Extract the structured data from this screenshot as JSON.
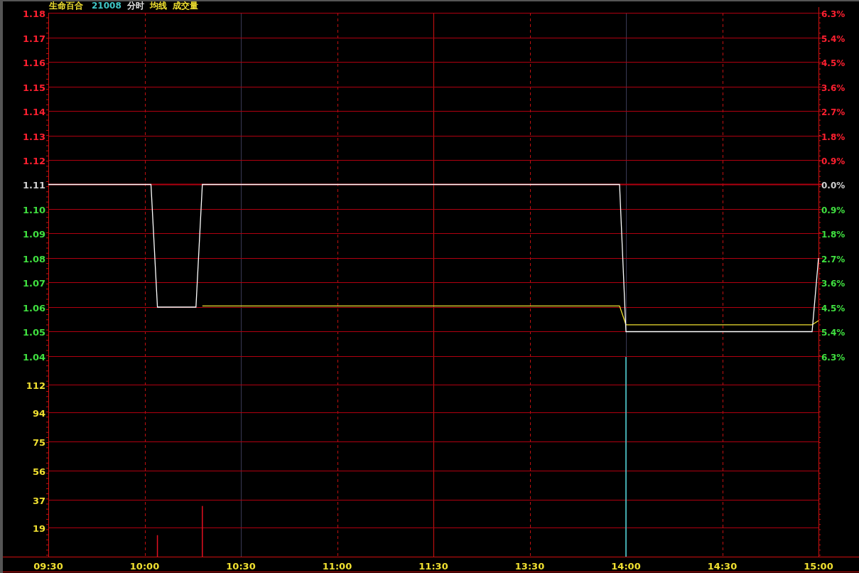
{
  "header": [
    {
      "kind": "name",
      "text": "生命百合",
      "color": "#f0e030"
    },
    {
      "kind": "code",
      "text": "21008",
      "color": "#40c8c8"
    },
    {
      "kind": "label",
      "text": "分时",
      "color": "#e0e0e0"
    },
    {
      "kind": "label",
      "text": "均线",
      "color": "#f0e030"
    },
    {
      "kind": "label",
      "text": "成交量",
      "color": "#f0e030"
    }
  ],
  "axis_rows": [
    {
      "percent": "6.3%",
      "color": "#ff2030"
    },
    {
      "percent": "5.4%",
      "color": "#ff2030"
    },
    {
      "percent": "4.5%",
      "color": "#ff2030"
    },
    {
      "percent": "3.6%",
      "color": "#ff2030"
    },
    {
      "percent": "2.7%",
      "color": "#ff2030"
    },
    {
      "percent": "1.8%",
      "color": "#ff2030"
    },
    {
      "percent": "0.9%",
      "color": "#ff2030"
    },
    {
      "percent": "0.0%",
      "color": "#d0d0d0"
    },
    {
      "percent": "0.9%",
      "color": "#40e040"
    },
    {
      "percent": "1.8%",
      "color": "#40e040"
    },
    {
      "percent": "2.7%",
      "color": "#40e040"
    },
    {
      "percent": "3.6%",
      "color": "#40e040"
    },
    {
      "percent": "4.5%",
      "color": "#40e040"
    },
    {
      "percent": "5.4%",
      "color": "#40e040"
    },
    {
      "percent": "6.3%",
      "color": "#40e040"
    }
  ],
  "price_chart": {
    "chart_data": {
      "type": "line",
      "categories": [
        null,
        null,
        null,
        null,
        null,
        null,
        null,
        null,
        null,
        null,
        null,
        null,
        null,
        null,
        null,
        null,
        null,
        null,
        null,
        null,
        null,
        null,
        null,
        null,
        null,
        null,
        null,
        null,
        null,
        null,
        null,
        null,
        null,
        null,
        null,
        null,
        null,
        null,
        null,
        null,
        null,
        null,
        null,
        null,
        null,
        null,
        null,
        null,
        null,
        null,
        null,
        null,
        null,
        null,
        null,
        null,
        null,
        null,
        null,
        null,
        null,
        null,
        null,
        null,
        null,
        null,
        null,
        null,
        null,
        null,
        null,
        null,
        null,
        null,
        null,
        null,
        null,
        null,
        null,
        null,
        null,
        null,
        null,
        null,
        null,
        null,
        null,
        null,
        null,
        null,
        null,
        null,
        null,
        null,
        null,
        null,
        null,
        null,
        null,
        null,
        null,
        null,
        null,
        null,
        null,
        null,
        null,
        null,
        null,
        null,
        null,
        null,
        null,
        null,
        null,
        null,
        null,
        null,
        null,
        null,
        null
      ],
      "series": [
        {
          "color": "#ffffff",
          "values": [
            1.11,
            1.11,
            1.11,
            1.11,
            1.11,
            1.11,
            1.11,
            1.11,
            1.11,
            1.11,
            1.11,
            1.11,
            1.11,
            1.11,
            1.11,
            1.11,
            1.11,
            1.06,
            1.06,
            1.06,
            1.06,
            1.06,
            1.06,
            1.06,
            1.11,
            1.11,
            1.11,
            1.11,
            1.11,
            1.11,
            1.11,
            1.11,
            1.11,
            1.11,
            1.11,
            1.11,
            1.11,
            1.11,
            1.11,
            1.11,
            1.11,
            1.11,
            1.11,
            1.11,
            1.11,
            1.11,
            1.11,
            1.11,
            1.11,
            1.11,
            1.11,
            1.11,
            1.11,
            1.11,
            1.11,
            1.11,
            1.11,
            1.11,
            1.11,
            1.11,
            1.11,
            1.11,
            1.11,
            1.11,
            1.11,
            1.11,
            1.11,
            1.11,
            1.11,
            1.11,
            1.11,
            1.11,
            1.11,
            1.11,
            1.11,
            1.11,
            1.11,
            1.11,
            1.11,
            1.11,
            1.11,
            1.11,
            1.11,
            1.11,
            1.11,
            1.11,
            1.11,
            1.11,
            1.11,
            1.11,
            1.05,
            1.05,
            1.05,
            1.05,
            1.05,
            1.05,
            1.05,
            1.05,
            1.05,
            1.05,
            1.05,
            1.05,
            1.05,
            1.05,
            1.05,
            1.05,
            1.05,
            1.05,
            1.05,
            1.05,
            1.05,
            1.05,
            1.05,
            1.05,
            1.05,
            1.05,
            1.05,
            1.05,
            1.05,
            1.05,
            1.08
          ]
        },
        {
          "color": "#f0e030",
          "values": [
            null,
            null,
            null,
            null,
            null,
            null,
            null,
            null,
            null,
            null,
            null,
            null,
            null,
            null,
            null,
            null,
            null,
            null,
            null,
            null,
            null,
            null,
            null,
            null,
            1.0605,
            1.0605,
            1.0605,
            1.0605,
            1.0605,
            1.0605,
            1.0605,
            1.0605,
            1.0605,
            1.0605,
            1.0605,
            1.0605,
            1.0605,
            1.0605,
            1.0605,
            1.0605,
            1.0605,
            1.0605,
            1.0605,
            1.0605,
            1.0605,
            1.0605,
            1.0605,
            1.0605,
            1.0605,
            1.0605,
            1.0605,
            1.0605,
            1.0605,
            1.0605,
            1.0605,
            1.0605,
            1.0605,
            1.0605,
            1.0605,
            1.0605,
            1.0605,
            1.0605,
            1.0605,
            1.0605,
            1.0605,
            1.0605,
            1.0605,
            1.0605,
            1.0605,
            1.0605,
            1.0605,
            1.0605,
            1.0605,
            1.0605,
            1.0605,
            1.0605,
            1.0605,
            1.0605,
            1.0605,
            1.0605,
            1.0605,
            1.0605,
            1.0605,
            1.0605,
            1.0605,
            1.0605,
            1.0605,
            1.0605,
            1.0605,
            1.0605,
            1.0528,
            1.0528,
            1.0528,
            1.0528,
            1.0528,
            1.0528,
            1.0528,
            1.0528,
            1.0528,
            1.0528,
            1.0528,
            1.0528,
            1.0528,
            1.0528,
            1.0528,
            1.0528,
            1.0528,
            1.0528,
            1.0528,
            1.0528,
            1.0528,
            1.0528,
            1.0528,
            1.0528,
            1.0528,
            1.0528,
            1.0528,
            1.0528,
            1.0528,
            1.0528,
            1.0545
          ]
        }
      ],
      "ylim": [
        1.04,
        1.18
      ],
      "yticks": [
        {
          "value": 1.18,
          "label": "1.18"
        },
        {
          "value": 1.17,
          "label": "1.17"
        },
        {
          "value": 1.16,
          "label": "1.16"
        },
        {
          "value": 1.15,
          "label": "1.15"
        },
        {
          "value": 1.14,
          "label": "1.14"
        },
        {
          "value": 1.13,
          "label": "1.13"
        },
        {
          "value": 1.12,
          "label": "1.12"
        },
        {
          "value": 1.11,
          "label": "1.11"
        },
        {
          "value": 1.1,
          "label": "1.10"
        },
        {
          "value": 1.09,
          "label": "1.09"
        },
        {
          "value": 1.08,
          "label": "1.08"
        },
        {
          "value": 1.07,
          "label": "1.07"
        },
        {
          "value": 1.06,
          "label": "1.06"
        },
        {
          "value": 1.05,
          "label": "1.05"
        },
        {
          "value": 1.04,
          "label": "1.04"
        }
      ]
    }
  },
  "volume_chart": {
    "chart_data": {
      "type": "bar",
      "categories": [
        "09:30",
        null,
        null,
        null,
        null,
        null,
        null,
        null,
        null,
        null,
        null,
        null,
        null,
        null,
        null,
        "10:00",
        null,
        null,
        null,
        null,
        null,
        null,
        null,
        null,
        null,
        null,
        null,
        null,
        null,
        null,
        "10:30",
        null,
        null,
        null,
        null,
        null,
        null,
        null,
        null,
        null,
        null,
        null,
        null,
        null,
        null,
        "11:00",
        null,
        null,
        null,
        null,
        null,
        null,
        null,
        null,
        null,
        null,
        null,
        null,
        null,
        null,
        "11:30",
        null,
        null,
        null,
        null,
        null,
        null,
        null,
        null,
        null,
        null,
        null,
        null,
        null,
        null,
        "13:30",
        null,
        null,
        null,
        null,
        null,
        null,
        null,
        null,
        null,
        null,
        null,
        null,
        null,
        null,
        "14:00",
        null,
        null,
        null,
        null,
        null,
        null,
        null,
        null,
        null,
        null,
        null,
        null,
        null,
        null,
        "14:30",
        null,
        null,
        null,
        null,
        null,
        null,
        null,
        null,
        null,
        null,
        null,
        null,
        null,
        null,
        "15:00"
      ],
      "series": [
        {
          "color": "#e01020",
          "values": [
            null,
            null,
            null,
            null,
            null,
            null,
            null,
            null,
            null,
            null,
            null,
            null,
            null,
            null,
            null,
            null,
            null,
            14,
            null,
            null,
            null,
            null,
            null,
            null,
            33,
            null,
            null,
            null,
            null,
            null,
            null,
            null,
            null,
            null,
            null,
            null,
            null,
            null,
            null,
            null,
            null,
            null,
            null,
            null,
            null,
            null,
            null,
            null,
            null,
            null,
            null,
            null,
            null,
            null,
            null,
            null,
            null,
            null,
            null,
            null,
            null,
            null,
            null,
            null,
            null,
            null,
            null,
            null,
            null,
            null,
            null,
            null,
            null,
            null,
            null,
            null,
            null,
            null,
            null,
            null,
            null,
            null,
            null,
            null,
            null,
            null,
            null,
            null,
            null,
            null,
            null,
            null,
            null,
            null,
            null,
            null,
            null,
            null,
            null,
            null,
            null,
            null,
            null,
            null,
            null,
            null,
            null,
            null,
            null,
            null,
            null,
            null,
            null,
            null,
            null,
            null,
            null,
            null,
            null,
            null,
            null
          ]
        },
        {
          "color": "#50d8d8",
          "values": [
            null,
            null,
            null,
            null,
            null,
            null,
            null,
            null,
            null,
            null,
            null,
            null,
            null,
            null,
            null,
            null,
            null,
            null,
            null,
            null,
            null,
            null,
            null,
            null,
            null,
            null,
            null,
            null,
            null,
            null,
            null,
            null,
            null,
            null,
            null,
            null,
            null,
            null,
            null,
            null,
            null,
            null,
            null,
            null,
            null,
            null,
            null,
            null,
            null,
            null,
            null,
            null,
            null,
            null,
            null,
            null,
            null,
            null,
            null,
            null,
            null,
            null,
            null,
            null,
            null,
            null,
            null,
            null,
            null,
            null,
            null,
            null,
            null,
            null,
            null,
            null,
            null,
            null,
            null,
            null,
            null,
            null,
            null,
            null,
            null,
            null,
            null,
            null,
            null,
            null,
            130,
            null,
            null,
            null,
            null,
            null,
            null,
            null,
            null,
            null,
            null,
            null,
            null,
            null,
            null,
            null,
            null,
            null,
            null,
            null,
            null,
            null,
            null,
            null,
            null,
            null,
            null,
            null,
            null,
            null,
            null
          ]
        }
      ],
      "ylim": [
        0,
        130.5
      ],
      "yticks": [
        {
          "value": 112,
          "label": "112"
        },
        {
          "value": 94,
          "label": "94"
        },
        {
          "value": 75,
          "label": "75"
        },
        {
          "value": 56,
          "label": "56"
        },
        {
          "value": 37,
          "label": "37"
        },
        {
          "value": 19,
          "label": "19"
        }
      ]
    }
  }
}
